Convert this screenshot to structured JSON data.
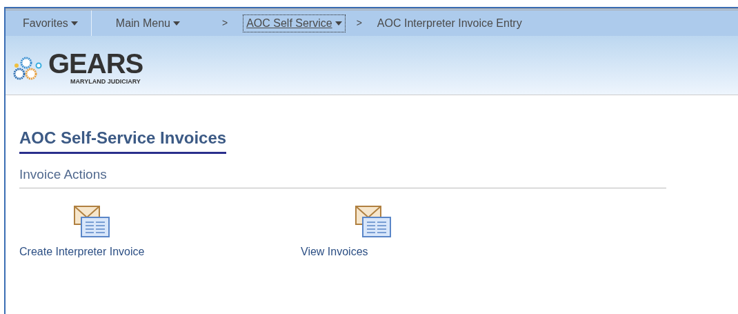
{
  "nav": [
    {
      "kind": "dropdown",
      "label": "Favorites",
      "focused": false
    },
    {
      "kind": "divider"
    },
    {
      "kind": "dropdown",
      "label": "Main Menu",
      "focused": false
    },
    {
      "kind": "separator",
      "label": ">"
    },
    {
      "kind": "dropdown",
      "label": "AOC Self Service",
      "focused": true
    },
    {
      "kind": "separator",
      "label": ">"
    },
    {
      "kind": "text",
      "label": "AOC Interpreter Invoice Entry"
    }
  ],
  "logo": {
    "name": "GEARS",
    "subtitle": "MARYLAND JUDICIARY"
  },
  "page_title": "AOC Self-Service Invoices",
  "section": "Invoice Actions",
  "actions": [
    {
      "label": "Create Interpreter Invoice"
    },
    {
      "label": "View Invoices"
    }
  ]
}
